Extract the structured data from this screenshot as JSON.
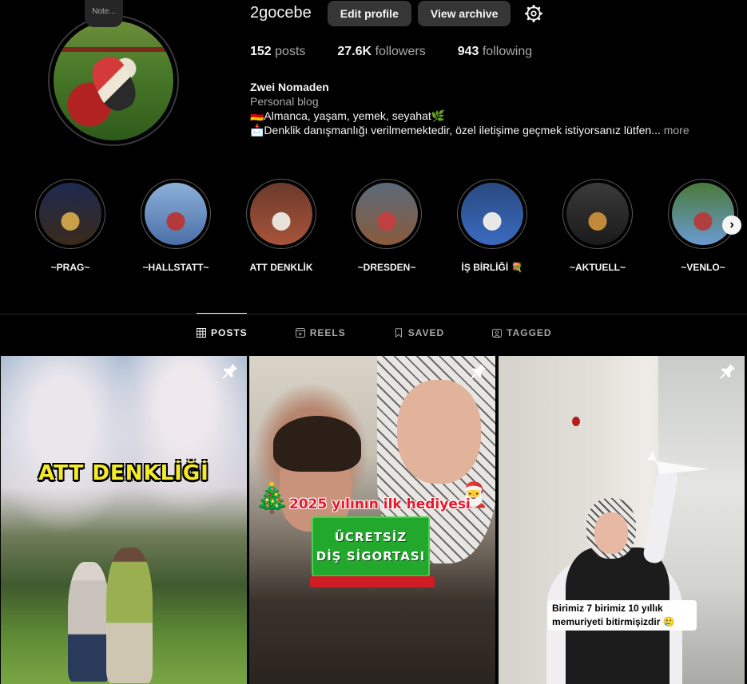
{
  "profile": {
    "note": "Note...",
    "username": "2gocebe",
    "edit_profile_label": "Edit profile",
    "view_archive_label": "View archive",
    "settings_icon": "gear-icon"
  },
  "stats": {
    "posts_count": "152",
    "posts_label": "posts",
    "followers_count": "27.6K",
    "followers_label": "followers",
    "following_count": "943",
    "following_label": "following"
  },
  "bio": {
    "name": "Zwei Nomaden",
    "category": "Personal blog",
    "line1": "🇩🇪Almanca, yaşam, yemek, seyahat🌿",
    "line2": "📩Denklik danışmanlığı verilmemektedir, özel iletişime geçmek istiyorsanız lütfen...",
    "more": "more"
  },
  "highlights": [
    {
      "label": "~PRAG~",
      "colors": [
        "#3a2a1a",
        "#c9a04a",
        "#1e2a50"
      ]
    },
    {
      "label": "~HALLSTATT~",
      "colors": [
        "#4a6fa8",
        "#b23a3a",
        "#8db0d8"
      ]
    },
    {
      "label": "ATT DENKLİK",
      "colors": [
        "#a8543a",
        "#e8e2d8",
        "#6a3a2a"
      ]
    },
    {
      "label": "~DRESDEN~",
      "colors": [
        "#8a5a3a",
        "#c04040",
        "#5a6a7a"
      ]
    },
    {
      "label": "İŞ BİRLİĞİ 💐",
      "colors": [
        "#3a6ac0",
        "#e8e8e8",
        "#2a4a80"
      ]
    },
    {
      "label": "~AKTUELL~",
      "colors": [
        "#1a1a1a",
        "#c08a3a",
        "#3a3a3a"
      ]
    },
    {
      "label": "~VENLO~",
      "colors": [
        "#6a9ad0",
        "#b04040",
        "#4a7a3a"
      ]
    }
  ],
  "highlights_next_icon": "chevron-right-icon",
  "tabs": [
    {
      "label": "POSTS",
      "icon": "grid-icon",
      "active": true
    },
    {
      "label": "REELS",
      "icon": "reels-icon",
      "active": false
    },
    {
      "label": "SAVED",
      "icon": "bookmark-icon",
      "active": false
    },
    {
      "label": "TAGGED",
      "icon": "tagged-icon",
      "active": false
    }
  ],
  "posts": [
    {
      "overlay_text": "ATT DENKLİĞİ",
      "pinned": true
    },
    {
      "overlay_text": "2025 yılının ilk hediyesi",
      "box_line1": "ÜCRETSİZ",
      "box_line2": "DİŞ SİGORTASI",
      "pinned": true
    },
    {
      "overlay_text": "Birimiz 7 birimiz 10 yıllık memuriyeti bitirmişizdir 🥲",
      "pinned": true
    }
  ]
}
